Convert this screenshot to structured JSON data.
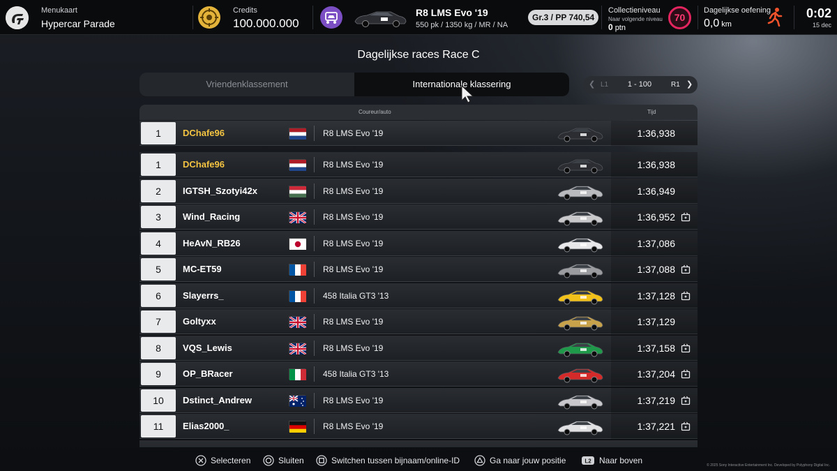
{
  "header": {
    "menu_label": "Menukaart",
    "menu_value": "Hypercar Parade",
    "credits_label": "Credits",
    "credits_value": "100.000.000",
    "car_name": "R8 LMS Evo '19",
    "car_specs": "550 pk / 1350 kg / MR / NA",
    "pp_badge": "Gr.3 / PP 740,54",
    "collection_label": "Collectieniveau",
    "collection_sub": "Naar volgende niveau",
    "collection_points": "0",
    "collection_unit": "ptn",
    "level": "70",
    "daily_label": "Dagelijkse oefening",
    "daily_value": "0,0",
    "daily_unit": "km",
    "clock_time": "0:02",
    "clock_date": "15 dec",
    "icons": [
      "gt-logo-icon",
      "credits-coin-icon",
      "garage-car-icon",
      "runner-icon"
    ],
    "level_color": "#e2245f"
  },
  "page": {
    "title": "Dagelijkse races Race C",
    "tabs": [
      "Vriendenklassement",
      "Internationale klassering"
    ],
    "active_tab": "Internationale klassering",
    "pager": {
      "left": "L1",
      "range": "1 - 100",
      "right": "R1"
    }
  },
  "leaderboard": {
    "col_driver": "Coureur/auto",
    "col_time": "Tijd",
    "pinned": {
      "pos": "1",
      "name": "DChafe96",
      "flag": "nl",
      "car": "R8 LMS Evo '19",
      "time": "1:36,938"
    },
    "rows": [
      {
        "pos": "1",
        "name": "DChafe96",
        "flag": "nl",
        "car": "R8 LMS Evo '19",
        "time": "1:36,938",
        "replay": false,
        "me": true
      },
      {
        "pos": "2",
        "name": "IGTSH_Szotyi42x",
        "flag": "hu",
        "car": "R8 LMS Evo '19",
        "time": "1:36,949",
        "replay": false,
        "me": false
      },
      {
        "pos": "3",
        "name": "Wind_Racing",
        "flag": "gb",
        "car": "R8 LMS Evo '19",
        "time": "1:36,952",
        "replay": true,
        "me": false
      },
      {
        "pos": "4",
        "name": "HeAvN_RB26",
        "flag": "jp",
        "car": "R8 LMS Evo '19",
        "time": "1:37,086",
        "replay": false,
        "me": false
      },
      {
        "pos": "5",
        "name": "MC-ET59",
        "flag": "fr",
        "car": "R8 LMS Evo '19",
        "time": "1:37,088",
        "replay": true,
        "me": false
      },
      {
        "pos": "6",
        "name": "Slayerrs_",
        "flag": "fr",
        "car": "458 Italia GT3 '13",
        "time": "1:37,128",
        "replay": true,
        "me": false
      },
      {
        "pos": "7",
        "name": "Goltyxx",
        "flag": "gb",
        "car": "R8 LMS Evo '19",
        "time": "1:37,129",
        "replay": false,
        "me": false
      },
      {
        "pos": "8",
        "name": "VQS_Lewis",
        "flag": "gb",
        "car": "R8 LMS Evo '19",
        "time": "1:37,158",
        "replay": true,
        "me": false
      },
      {
        "pos": "9",
        "name": "OP_BRacer",
        "flag": "it",
        "car": "458 Italia GT3 '13",
        "time": "1:37,204",
        "replay": true,
        "me": false
      },
      {
        "pos": "10",
        "name": "Dstinct_Andrew",
        "flag": "au",
        "car": "R8 LMS Evo '19",
        "time": "1:37,219",
        "replay": true,
        "me": false
      },
      {
        "pos": "11",
        "name": "Elias2000_",
        "flag": "de",
        "car": "R8 LMS Evo '19",
        "time": "1:37,221",
        "replay": true,
        "me": false
      }
    ],
    "car_colors": [
      "#2b2d33",
      "#2b2d33",
      "#b8babe",
      "#c9c9cc",
      "#e8e8ea",
      "#9a9ca0",
      "#f2c21b",
      "#c8a24a",
      "#1f9a4a",
      "#d42a2a",
      "#c8c8cc",
      "#e0e0e2"
    ]
  },
  "footer": {
    "hints": [
      {
        "icon": "cross-button-icon",
        "label": "Selecteren"
      },
      {
        "icon": "circle-button-icon",
        "label": "Sluiten"
      },
      {
        "icon": "square-button-icon",
        "label": "Switchen tussen bijnaam/online-ID"
      },
      {
        "icon": "triangle-button-icon",
        "label": "Ga naar jouw positie"
      },
      {
        "icon": "l2-button-icon",
        "label": "Naar boven"
      }
    ],
    "copyright": "© 2025 Sony Interactive Entertainment Inc. Developed by Polyphony Digital Inc."
  }
}
